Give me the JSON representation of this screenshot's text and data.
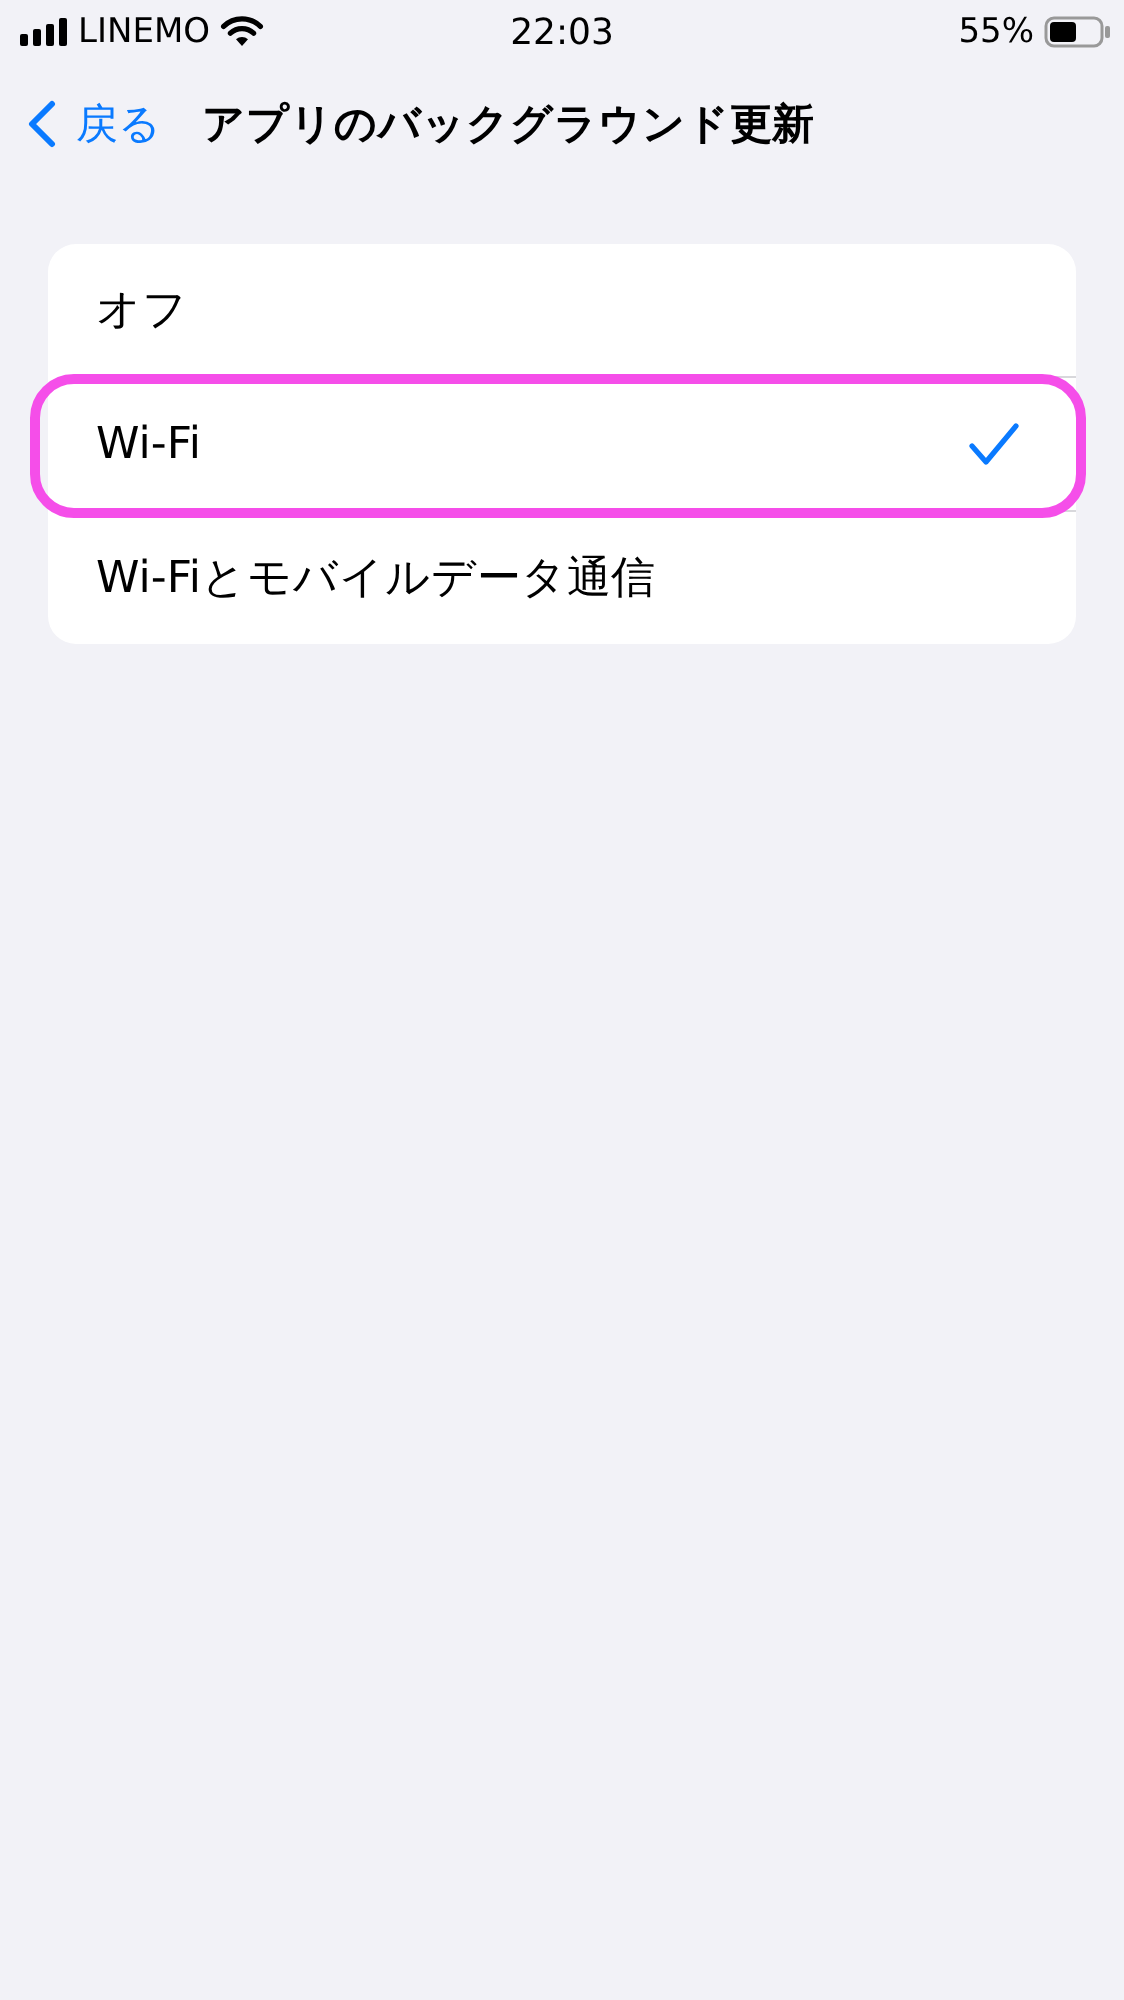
{
  "status_bar": {
    "carrier": "LINEMO",
    "time": "22:03",
    "battery": "55%"
  },
  "nav": {
    "back": "戻る",
    "title": "アプリのバックグラウンド更新"
  },
  "options": [
    {
      "label": "オフ",
      "selected": false,
      "highlighted": false
    },
    {
      "label": "Wi-Fi",
      "selected": true,
      "highlighted": true
    },
    {
      "label": "Wi-Fiとモバイルデータ通信",
      "selected": false,
      "highlighted": false
    }
  ]
}
